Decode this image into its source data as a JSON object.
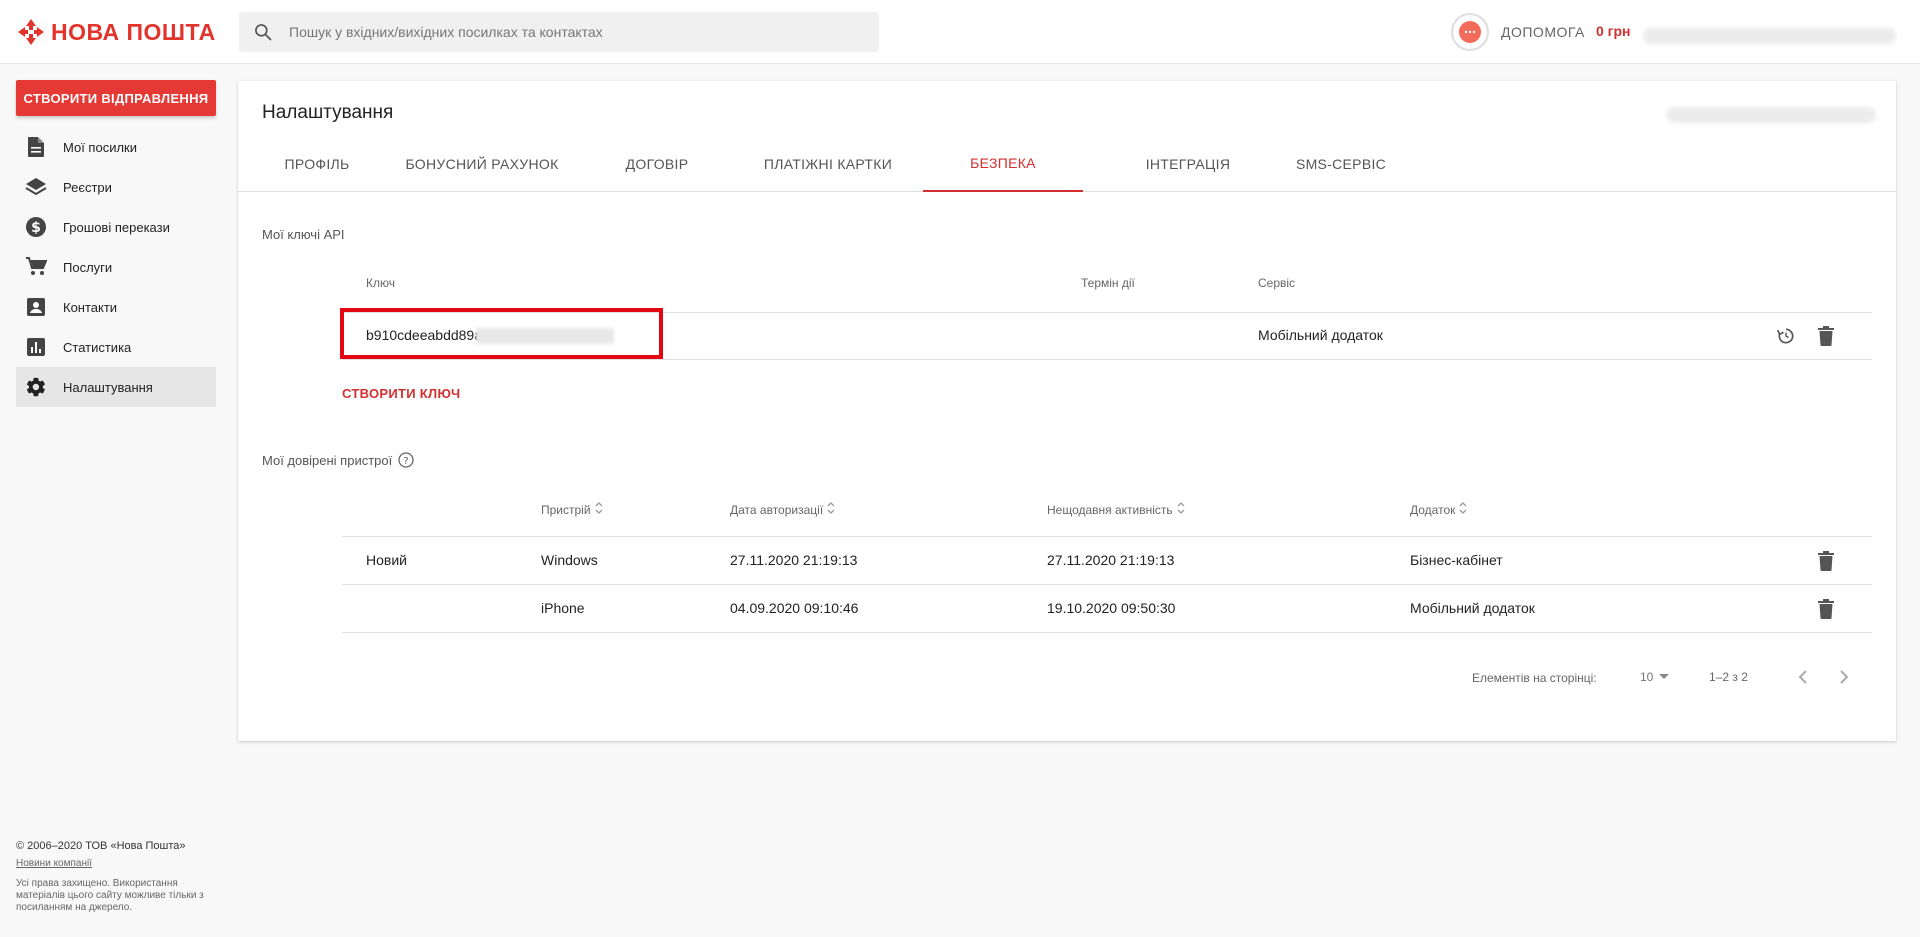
{
  "brand": {
    "logo_text": "НОВА ПОШТА",
    "color": "#e2342d"
  },
  "header": {
    "search_placeholder": "Пошук у вхідних/вихідних посилках та контактах",
    "help_label": "ДОПОМОГА",
    "balance": "0 грн"
  },
  "sidebar": {
    "create_button": "СТВОРИТИ ВІДПРАВЛЕННЯ",
    "items": [
      {
        "label": "Мої посилки",
        "icon": "document-icon"
      },
      {
        "label": "Реєстри",
        "icon": "layers-icon"
      },
      {
        "label": "Грошові перекази",
        "icon": "dollar-icon"
      },
      {
        "label": "Послуги",
        "icon": "cart-icon"
      },
      {
        "label": "Контакти",
        "icon": "contact-icon"
      },
      {
        "label": "Статистика",
        "icon": "chart-icon"
      },
      {
        "label": "Налаштування",
        "icon": "gear-icon",
        "active": true
      }
    ],
    "footer": {
      "copyright": "© 2006–2020 ТОВ «Нова Пошта»",
      "news_link": "Новини компанії",
      "rights": "Усі права захищено. Використання матеріалів цього сайту можливе тільки з посиланням на джерело."
    }
  },
  "page": {
    "title": "Налаштування",
    "tabs": [
      "ПРОФІЛЬ",
      "БОНУСНИЙ РАХУНОК",
      "ДОГОВІР",
      "ПЛАТІЖНІ КАРТКИ",
      "БЕЗПЕКА",
      "ІНТЕГРАЦІЯ",
      "SMS-СЕРВІС"
    ],
    "active_tab": "БЕЗПЕКА"
  },
  "api_keys": {
    "section_label": "Мої ключі API",
    "columns": {
      "key": "Ключ",
      "expiry": "Термін дії",
      "service": "Сервіс"
    },
    "rows": [
      {
        "key": "b910cdeeabdd89a",
        "expiry": "",
        "service": "Мобільний додаток"
      }
    ],
    "create_label": "СТВОРИТИ КЛЮЧ"
  },
  "devices": {
    "section_label": "Мої довірені пристрої",
    "columns": {
      "device": "Пристрій",
      "auth_date": "Дата авторизації",
      "last_activity": "Нещодавня активність",
      "app": "Додаток"
    },
    "rows": [
      {
        "status": "Новий",
        "device": "Windows",
        "auth_date": "27.11.2020 21:19:13",
        "last_activity": "27.11.2020 21:19:13",
        "app": "Бізнес-кабінет"
      },
      {
        "status": "",
        "device": "iPhone",
        "auth_date": "04.09.2020 09:10:46",
        "last_activity": "19.10.2020 09:50:30",
        "app": "Мобільний додаток"
      }
    ],
    "pager": {
      "per_page_label": "Елементів на сторінці:",
      "per_page": "10",
      "range": "1–2 з 2"
    }
  }
}
